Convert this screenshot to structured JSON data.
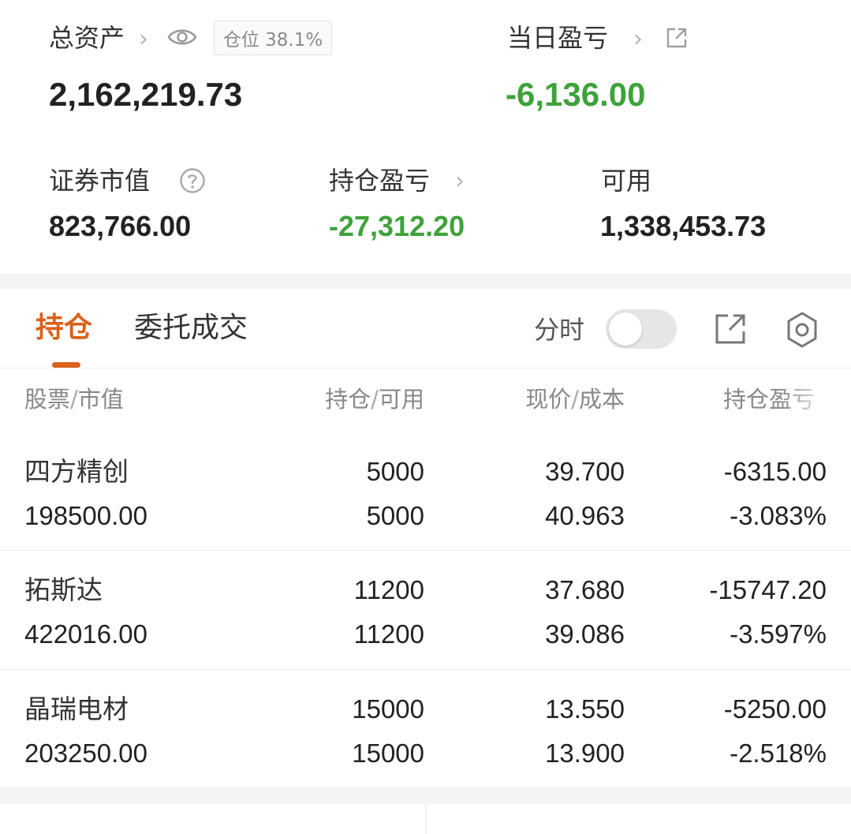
{
  "summary": {
    "total_assets_label": "总资产",
    "position_badge": "仓位 38.1%",
    "total_assets_value": "2,162,219.73",
    "daily_pnl_label": "当日盈亏",
    "daily_pnl_value": "-6,136.00",
    "market_value_label": "证券市值",
    "market_value": "823,766.00",
    "holding_pnl_label": "持仓盈亏",
    "holding_pnl_value": "-27,312.20",
    "available_label": "可用",
    "available_value": "1,338,453.73"
  },
  "tabs": {
    "holdings": "持仓",
    "orders": "委托成交",
    "intraday_label": "分时"
  },
  "table": {
    "headers": {
      "stock": "股票",
      "market_value": "市值",
      "position": "持仓",
      "available": "可用",
      "price": "现价",
      "cost": "成本",
      "pnl": "持仓盈亏"
    },
    "rows": [
      {
        "name": "四方精创",
        "market_value": "198500.00",
        "position": "5000",
        "available": "5000",
        "price": "39.700",
        "cost": "40.963",
        "pnl": "-6315.00",
        "pnl_pct": "-3.083%"
      },
      {
        "name": "拓斯达",
        "market_value": "422016.00",
        "position": "11200",
        "available": "11200",
        "price": "37.680",
        "cost": "39.086",
        "pnl": "-15747.20",
        "pnl_pct": "-3.597%"
      },
      {
        "name": "晶瑞电材",
        "market_value": "203250.00",
        "position": "15000",
        "available": "15000",
        "price": "13.550",
        "cost": "13.900",
        "pnl": "-5250.00",
        "pnl_pct": "-2.518%"
      }
    ]
  },
  "colors": {
    "accent": "#d9621c",
    "loss_green": "#3ea23a",
    "text_primary": "#222222",
    "text_secondary": "#888888"
  },
  "icons": [
    "eye-icon",
    "chevron-right-icon",
    "external-link-icon",
    "question-icon",
    "settings-gear-icon"
  ]
}
